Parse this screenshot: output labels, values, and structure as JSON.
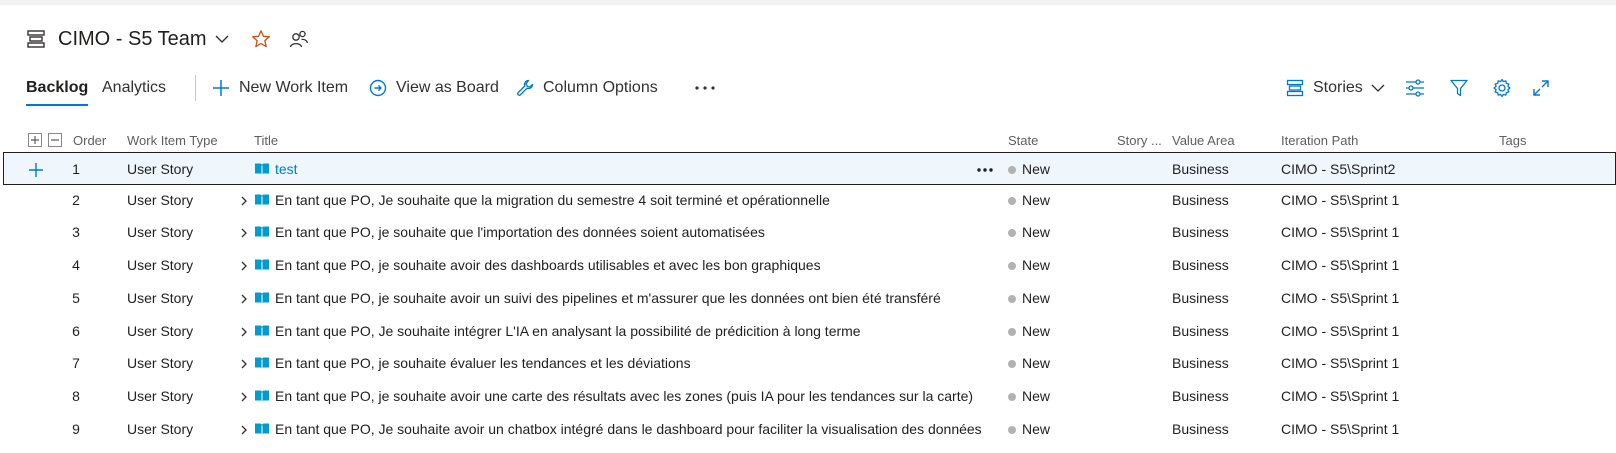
{
  "header": {
    "team_name": "CIMO - S5 Team"
  },
  "toolbar": {
    "tabs": [
      {
        "label": "Backlog",
        "active": true
      },
      {
        "label": "Analytics",
        "active": false
      }
    ],
    "new_work_item": "New Work Item",
    "view_as_board": "View as Board",
    "column_options": "Column Options",
    "more": "···",
    "backlog_level": "Stories"
  },
  "grid": {
    "columns": {
      "order": "Order",
      "work_item_type": "Work Item Type",
      "title": "Title",
      "state": "State",
      "story_points": "Story ...",
      "value_area": "Value Area",
      "iteration_path": "Iteration Path",
      "tags": "Tags"
    },
    "rows": [
      {
        "order": "1",
        "type": "User Story",
        "title": "test",
        "state": "New",
        "value_area": "Business",
        "iteration": "CIMO - S5\\Sprint2"
      },
      {
        "order": "2",
        "type": "User Story",
        "title": "En tant que PO, Je souhaite que la migration du semestre 4 soit terminé et opérationnelle",
        "state": "New",
        "value_area": "Business",
        "iteration": "CIMO - S5\\Sprint 1"
      },
      {
        "order": "3",
        "type": "User Story",
        "title": "En tant que PO, je souhaite que l'importation des données soient automatisées",
        "state": "New",
        "value_area": "Business",
        "iteration": "CIMO - S5\\Sprint 1"
      },
      {
        "order": "4",
        "type": "User Story",
        "title": "En tant que PO, je souhaite avoir des dashboards utilisables et avec les bon graphiques",
        "state": "New",
        "value_area": "Business",
        "iteration": "CIMO - S5\\Sprint 1"
      },
      {
        "order": "5",
        "type": "User Story",
        "title": "En tant que PO, je souhaite avoir un suivi des pipelines et m'assurer que les données ont bien été transféré",
        "state": "New",
        "value_area": "Business",
        "iteration": "CIMO - S5\\Sprint 1"
      },
      {
        "order": "6",
        "type": "User Story",
        "title": "En tant que PO, Je souhaite intégrer L'IA en analysant la possibilité de prédicition à long terme",
        "state": "New",
        "value_area": "Business",
        "iteration": "CIMO - S5\\Sprint 1"
      },
      {
        "order": "7",
        "type": "User Story",
        "title": "En tant que PO, je souhaite évaluer les tendances et les déviations",
        "state": "New",
        "value_area": "Business",
        "iteration": "CIMO - S5\\Sprint 1"
      },
      {
        "order": "8",
        "type": "User Story",
        "title": "En tant que PO, je souhaite avoir une carte des résultats avec les zones (puis IA pour les tendances sur la carte)",
        "state": "New",
        "value_area": "Business",
        "iteration": "CIMO - S5\\Sprint 1"
      },
      {
        "order": "9",
        "type": "User Story",
        "title": "En tant que PO, Je souhaite avoir un chatbox intégré dans le dashboard pour faciliter la visualisation des données",
        "state": "New",
        "value_area": "Business",
        "iteration": "CIMO - S5\\Sprint 1"
      }
    ]
  },
  "colors": {
    "accent": "#0078d4",
    "favorite_star": "#ca5010",
    "story_icon": "#009ccc",
    "state_new": "#b2b2b2",
    "selected_row": "#eff6fc"
  },
  "icons": [
    "backlog-icon",
    "chevron-down-icon",
    "star-icon",
    "team-members-icon",
    "plus-icon",
    "board-icon",
    "wrench-icon",
    "more-icon",
    "stories-icon",
    "view-options-icon",
    "filter-icon",
    "gear-icon",
    "fullscreen-icon",
    "expand-all-icon",
    "collapse-all-icon",
    "user-story-icon",
    "chevron-right-icon"
  ]
}
